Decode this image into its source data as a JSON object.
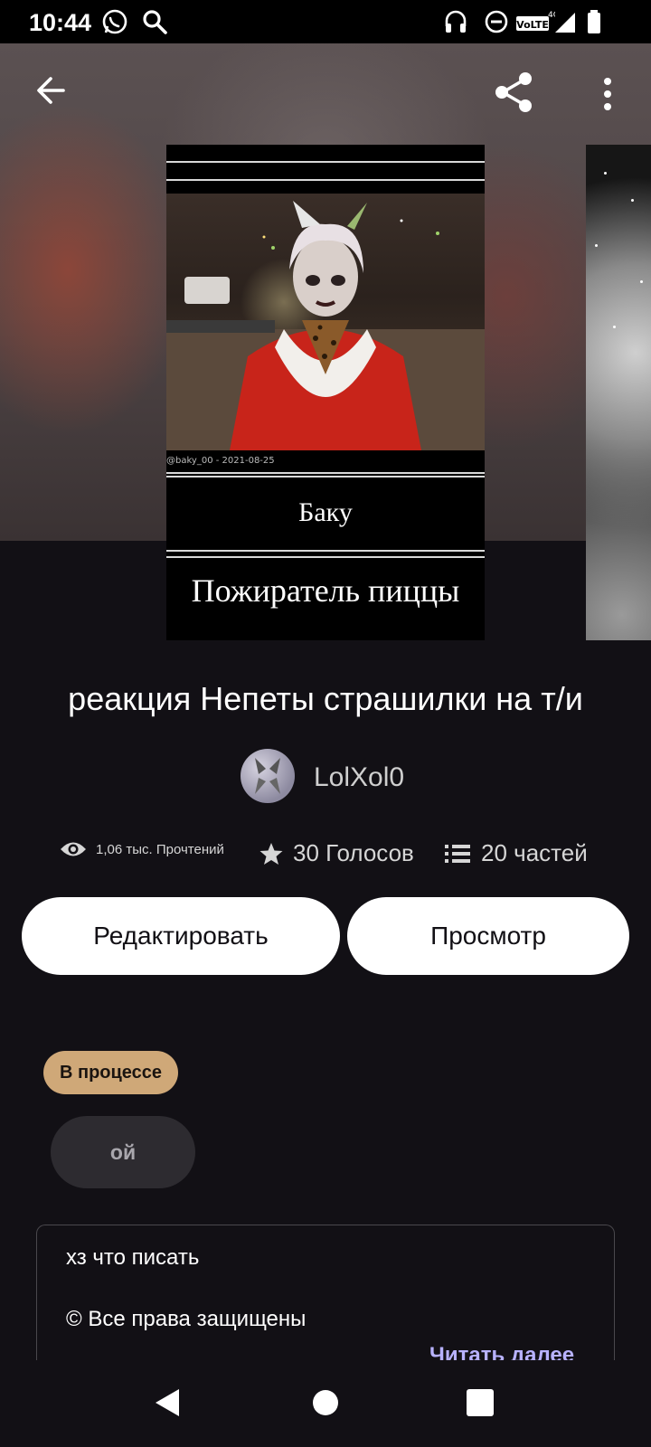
{
  "status_bar": {
    "time": "10:44",
    "left_icons": [
      "whatsapp-icon",
      "search-icon"
    ],
    "right_icons": [
      "headphones-icon",
      "do-not-disturb-icon",
      "volte-4g-icon",
      "signal-icon",
      "battery-icon"
    ]
  },
  "toolbar": {
    "back_icon": "arrow-back-icon",
    "share_icon": "share-icon",
    "menu_icon": "more-vert-icon"
  },
  "cover": {
    "watermark": "@baky_00 - 2021-08-25",
    "name": "Баку",
    "subtitle": "Пожиратель пиццы"
  },
  "story": {
    "title": "реакция Непеты страшилки на т/и",
    "author": "LolXol0",
    "reads": "1,06 тыс. Прочтений",
    "votes": "30 Голосов",
    "parts": "20 частей"
  },
  "actions": {
    "edit_label": "Редактировать",
    "preview_label": "Просмотр"
  },
  "status_tag": "В процессе",
  "tags": [
    "ой"
  ],
  "description": {
    "line1": "хз что писать",
    "line2": "© Все права защищены",
    "read_more": "Читать далее"
  },
  "nav": {
    "back_icon": "nav-back-icon",
    "home_icon": "nav-home-icon",
    "recents_icon": "nav-recents-icon"
  },
  "colors": {
    "background": "#121015",
    "status_tag": "#cfa878",
    "read_more": "#b8b2ff",
    "chip": "#2d2b30"
  }
}
